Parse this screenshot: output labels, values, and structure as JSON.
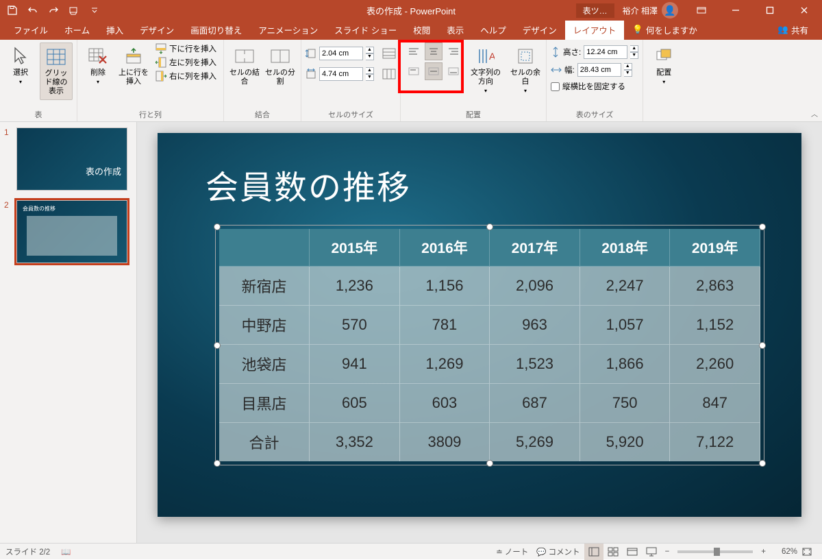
{
  "title": "表の作成 - PowerPoint",
  "contextualTab": "表ツ…",
  "user": "裕介 相澤",
  "tabs": {
    "file": "ファイル",
    "home": "ホーム",
    "insert": "挿入",
    "design": "デザイン",
    "transitions": "画面切り替え",
    "animations": "アニメーション",
    "slideshow": "スライド ショー",
    "review": "校閲",
    "view": "表示",
    "help": "ヘルプ",
    "tableDesign": "デザイン",
    "layout": "レイアウト",
    "tellme": "何をしますか",
    "share": "共有"
  },
  "ribbon": {
    "groups": {
      "table": "表",
      "rowsCols": "行と列",
      "merge": "結合",
      "cellSize": "セルのサイズ",
      "alignment": "配置",
      "tableSize": "表のサイズ",
      "arrange": "配置"
    },
    "select": "選択",
    "viewGrid": "グリッド線の表示",
    "delete": "削除",
    "insertAbove": "上に行を挿入",
    "insertBelow": "下に行を挿入",
    "insertLeft": "左に列を挿入",
    "insertRight": "右に列を挿入",
    "mergeCells": "セルの結合",
    "splitCells": "セルの分割",
    "rowHeight": "2.04 cm",
    "colWidth": "4.74 cm",
    "textDirection": "文字列の方向",
    "cellMargins": "セルの余白",
    "heightLabel": "高さ:",
    "widthLabel": "幅:",
    "heightVal": "12.24 cm",
    "widthVal": "28.43 cm",
    "lockAspect": "縦横比を固定する",
    "arrangeBtn": "配置"
  },
  "slide": {
    "title": "会員数の推移",
    "headers": [
      "",
      "2015年",
      "2016年",
      "2017年",
      "2018年",
      "2019年"
    ],
    "rows": [
      [
        "新宿店",
        "1,236",
        "1,156",
        "2,096",
        "2,247",
        "2,863"
      ],
      [
        "中野店",
        "570",
        "781",
        "963",
        "1,057",
        "1,152"
      ],
      [
        "池袋店",
        "941",
        "1,269",
        "1,523",
        "1,866",
        "2,260"
      ],
      [
        "目黒店",
        "605",
        "603",
        "687",
        "750",
        "847"
      ],
      [
        "合計",
        "3,352",
        "3809",
        "5,269",
        "5,920",
        "7,122"
      ]
    ]
  },
  "status": {
    "slideCounter": "スライド 2/2",
    "notes": "ノート",
    "comments": "コメント",
    "zoom": "62%"
  },
  "thumbs": {
    "n1": "1",
    "n2": "2"
  }
}
